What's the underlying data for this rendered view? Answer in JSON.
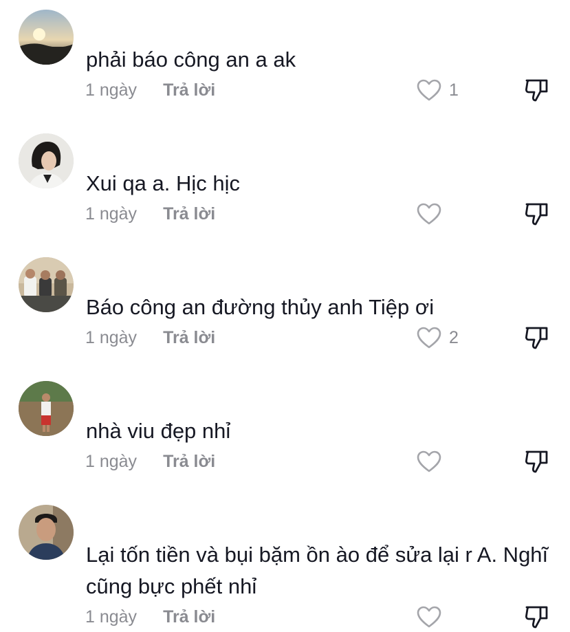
{
  "comments": [
    {
      "username": "",
      "text": "phải báo công an a ak",
      "time": "1 ngày",
      "reply_label": "Trả lời",
      "like_count": "1",
      "avatar_icon": "sunset-avatar"
    },
    {
      "username": "",
      "text": "Xui qa a. Hịc hịc",
      "time": "1 ngày",
      "reply_label": "Trả lời",
      "like_count": "",
      "avatar_icon": "girl-portrait-avatar"
    },
    {
      "username": "",
      "text": "Báo công an đường thủy anh Tiệp ơi",
      "time": "1 ngày",
      "reply_label": "Trả lời",
      "like_count": "2",
      "avatar_icon": "group-photo-avatar"
    },
    {
      "username": "",
      "text": "nhà viu đẹp nhỉ",
      "time": "1 ngày",
      "reply_label": "Trả lời",
      "like_count": "",
      "avatar_icon": "person-outdoor-avatar"
    },
    {
      "username": "",
      "text": "Lại tốn tiền và bụi bặm ồn ào để sửa lại r A. Nghĩ cũng bực phết nhỉ",
      "time": "1 ngày",
      "reply_label": "Trả lời",
      "like_count": "",
      "avatar_icon": "man-portrait-avatar"
    }
  ],
  "icons": {
    "like": "heart-outline-icon",
    "dislike": "thumbs-down-icon"
  },
  "colors": {
    "text": "#161823",
    "muted": "#8a8b91",
    "background": "#ffffff"
  }
}
